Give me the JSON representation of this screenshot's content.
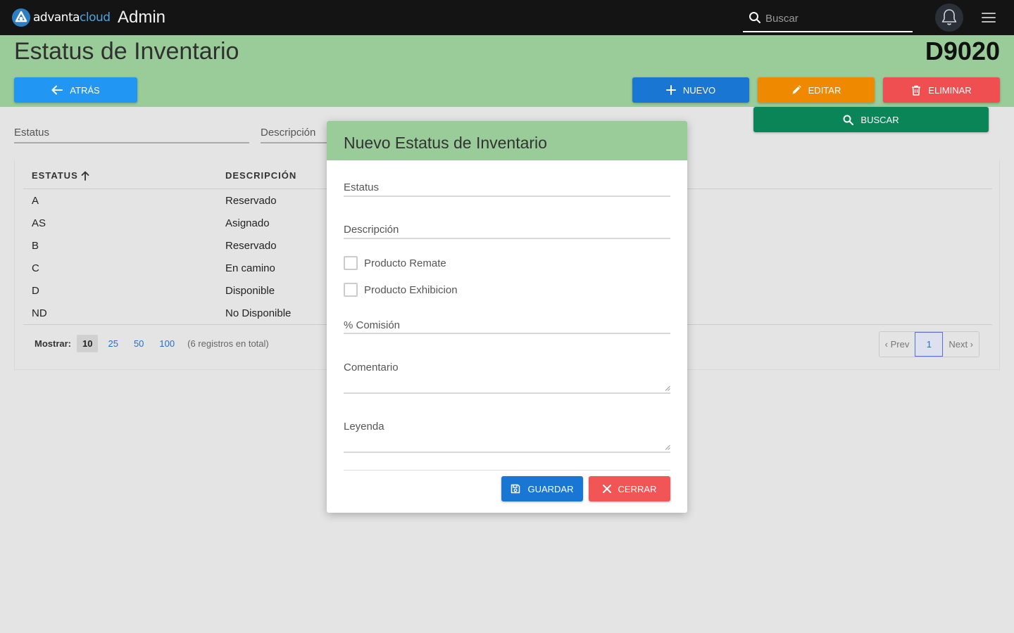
{
  "topbar": {
    "logo_part1": "advanta",
    "logo_part2": "cloud",
    "app_title": "Admin",
    "search_placeholder": "Buscar"
  },
  "header": {
    "title": "Estatus de Inventario",
    "code": "D9020",
    "back_label": "ATRÁS",
    "new_label": "NUEVO",
    "edit_label": "EDITAR",
    "delete_label": "ELIMINAR",
    "search_label": "BUSCAR"
  },
  "filters": {
    "estatus_label": "Estatus",
    "descripcion_label": "Descripción"
  },
  "table": {
    "columns": [
      "ESTATUS",
      "DESCRIPCIÓN"
    ],
    "rows": [
      {
        "estatus": "A",
        "descripcion": "Reservado"
      },
      {
        "estatus": "AS",
        "descripcion": "Asignado"
      },
      {
        "estatus": "B",
        "descripcion": "Reservado"
      },
      {
        "estatus": "C",
        "descripcion": "En camino"
      },
      {
        "estatus": "D",
        "descripcion": "Disponible"
      },
      {
        "estatus": "ND",
        "descripcion": "No Disponible"
      }
    ],
    "show_label": "Mostrar:",
    "page_sizes": [
      "10",
      "25",
      "50",
      "100"
    ],
    "total_text": "(6 registros en total)",
    "prev_label": "‹ Prev",
    "current_page": "1",
    "next_label": "Next ›"
  },
  "modal": {
    "title": "Nuevo Estatus de Inventario",
    "estatus_label": "Estatus",
    "descripcion_label": "Descripción",
    "remate_label": "Producto Remate",
    "exhibicion_label": "Producto Exhibicion",
    "comision_label": "% Comisión",
    "comentario_label": "Comentario",
    "leyenda_label": "Leyenda",
    "save_label": "GUARDAR",
    "close_label": "CERRAR"
  },
  "colors": {
    "topbar": "#141414",
    "header_green": "#99cc99",
    "primary": "#1976d2",
    "back": "#2196f3",
    "edit": "#ef8a00",
    "delete": "#ef4f51",
    "search": "#0a8558"
  }
}
